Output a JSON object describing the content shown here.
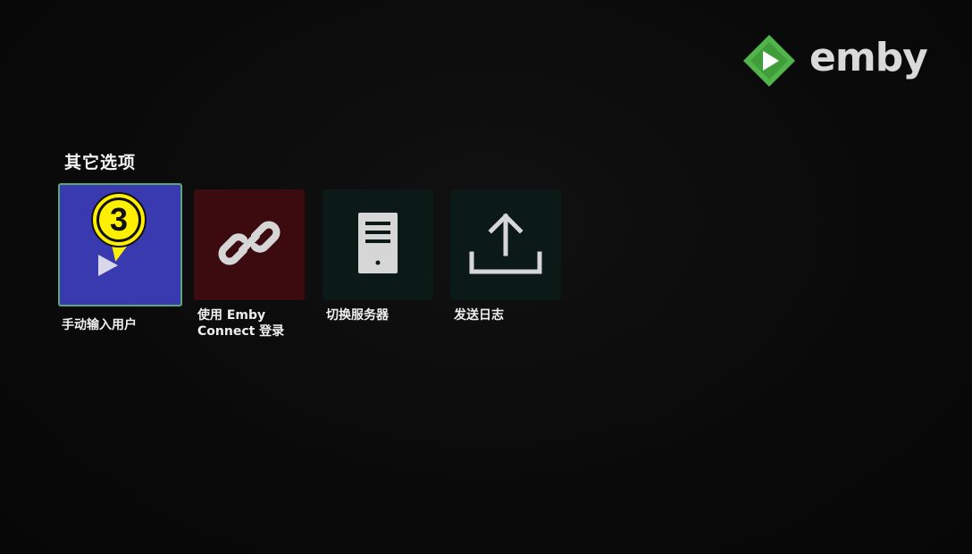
{
  "brand": {
    "name": "emby",
    "icon": "emby-logo-icon",
    "accent": "#52b54b"
  },
  "section": {
    "title": "其它选项"
  },
  "options": [
    {
      "label": "手动输入用户",
      "icon": "play-icon",
      "background": "#3a3ab0",
      "focused": true
    },
    {
      "label_line1": "使用 Emby",
      "label_line2": "Connect 登录",
      "icon": "link-chain-icon",
      "background": "#3b0b10",
      "focused": false
    },
    {
      "label": "切换服务器",
      "icon": "server-icon",
      "background": "#0c1a17",
      "focused": false
    },
    {
      "label": "发送日志",
      "icon": "upload-icon",
      "background": "#0c1a17",
      "focused": false
    }
  ],
  "callout": {
    "number": "3",
    "color": "#ffef00"
  }
}
